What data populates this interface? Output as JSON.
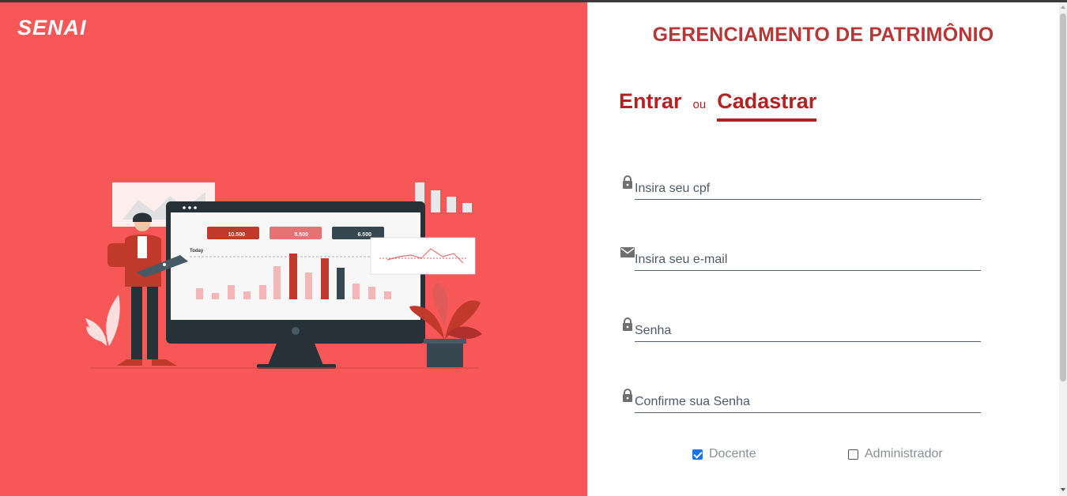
{
  "brand": {
    "logo_text": "SENAI"
  },
  "header": {
    "title": "GERENCIAMENTO DE PATRIMÔNIO"
  },
  "tabs": {
    "login_label": "Entrar",
    "separator": "ou",
    "register_label": "Cadastrar",
    "active": "register"
  },
  "form": {
    "cpf": {
      "placeholder": "Insira seu cpf",
      "value": "",
      "icon": "lock-icon"
    },
    "email": {
      "placeholder": "Insira seu e-mail",
      "value": "",
      "icon": "mail-icon"
    },
    "password": {
      "placeholder": "Senha",
      "value": "",
      "icon": "lock-icon"
    },
    "confirm_password": {
      "placeholder": "Confirme sua Senha",
      "value": "",
      "icon": "lock-icon"
    }
  },
  "roles": [
    {
      "label": "Docente",
      "checked": true
    },
    {
      "label": "Administrador",
      "checked": false
    }
  ],
  "illustration": {
    "cards": [
      "10.500",
      "8.500",
      "6.500"
    ],
    "chart_caption": "Today"
  },
  "colors": {
    "left_bg": "#f75757",
    "accent": "#b22222",
    "title": "#b83636"
  }
}
